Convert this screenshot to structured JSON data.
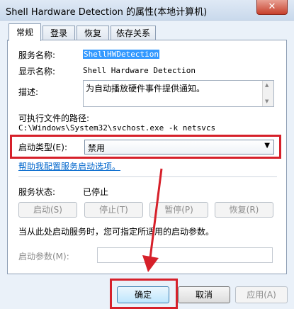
{
  "window": {
    "title": "Shell Hardware Detection 的属性(本地计算机)",
    "close_glyph": "✕"
  },
  "tabs": [
    {
      "label": "常规"
    },
    {
      "label": "登录"
    },
    {
      "label": "恢复"
    },
    {
      "label": "依存关系"
    }
  ],
  "general": {
    "service_name_label": "服务名称:",
    "service_name_value": "ShellHWDetection",
    "display_name_label": "显示名称:",
    "display_name_value": "Shell Hardware Detection",
    "description_label": "描述:",
    "description_value": "为自动播放硬件事件提供通知。",
    "exe_path_label": "可执行文件的路径:",
    "exe_path_value": "C:\\Windows\\System32\\svchost.exe -k netsvcs",
    "startup_type_label": "启动类型(E):",
    "startup_type_value": "禁用",
    "help_link": "帮助我配置服务启动选项。",
    "service_status_label": "服务状态:",
    "service_status_value": "已停止",
    "start_button": "启动(S)",
    "stop_button": "停止(T)",
    "pause_button": "暂停(P)",
    "resume_button": "恢复(R)",
    "hint_text": "当从此处启动服务时，您可指定所适用的启动参数。",
    "start_params_label": "启动参数(M):",
    "start_params_value": ""
  },
  "footer": {
    "ok_button": "确定",
    "cancel_button": "取消",
    "apply_button": "应用(A)"
  },
  "annotation": {
    "color": "#d6202a"
  }
}
